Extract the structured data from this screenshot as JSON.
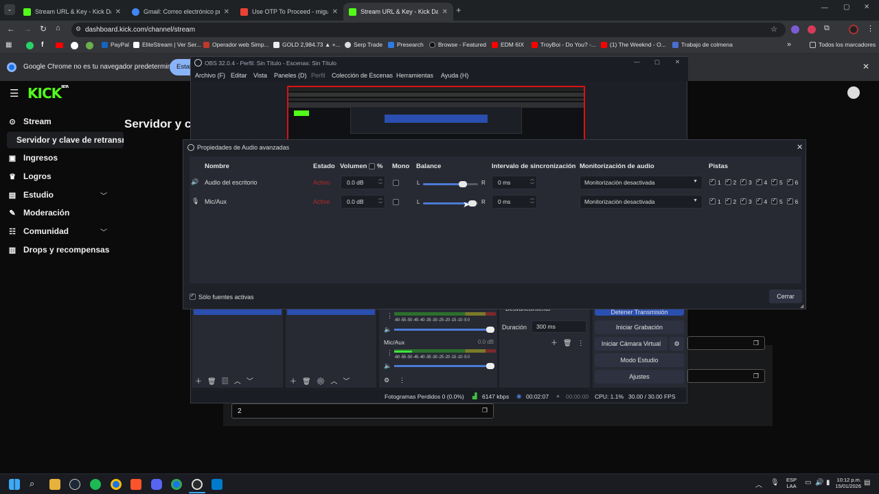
{
  "browser": {
    "tabs": [
      {
        "title": "Stream URL & Key - Kick Dashb",
        "fav": "#53fc18"
      },
      {
        "title": "Gmail: Correo electrónico priva",
        "fav": "#4285f4"
      },
      {
        "title": "Use OTP To Proceed - miguels",
        "fav": "#ea4335"
      },
      {
        "title": "Stream URL & Key - Kick Dashb",
        "fav": "#53fc18"
      }
    ],
    "new_tab": "+",
    "url": "dashboard.kick.com/channel/stream",
    "bookmarks": [
      "PayPal",
      "EliteStream | Ver Ser...",
      "Operador web Simp...",
      "GOLD 2,984.73 ▲ +...",
      "Serp Trade",
      "Presearch",
      "Browse - Featured",
      "EDM 6IX",
      "TroyBoi - Do You? -...",
      "(1) The Weeknd - O...",
      "Trabajo de colmena"
    ],
    "bookmarks_more": "»",
    "all_bookmarks": "Todos los marcadores",
    "infobar_text": "Google Chrome no es tu navegador predeterminado",
    "infobar_button": "Estab"
  },
  "kick": {
    "logo": "KICK",
    "logo_badge": "BETA",
    "sidebar": [
      {
        "label": "Stream",
        "icon": "broadcast-icon"
      },
      {
        "label": "Servidor y clave de retransm",
        "icon": ""
      },
      {
        "label": "Ingresos",
        "icon": "money-icon"
      },
      {
        "label": "Logros",
        "icon": "trophy-icon"
      },
      {
        "label": "Estudio",
        "icon": "studio-icon"
      },
      {
        "label": "Moderación",
        "icon": "wrench-icon"
      },
      {
        "label": "Comunidad",
        "icon": "community-icon"
      },
      {
        "label": "Drops y recompensas",
        "icon": "drops-icon"
      }
    ],
    "heading": "Servidor y cl",
    "field_value": "2"
  },
  "obs": {
    "title": "OBS 32.0.4 - Perfil: Sin Título - Escenas: Sin Título",
    "menu": [
      "Archivo (F)",
      "Editar",
      "Vista",
      "Paneles (D)",
      "Perfil",
      "Colección de Escenas",
      "Herramientas",
      "Ayuda (H)"
    ],
    "mixer_track": "Mic/Aux",
    "mixer_db": "0.0 dB",
    "meter_scale": "-60 -55 -50 -45 -40 -35 -30 -25 -20 -15 -10 -5 0",
    "transition_label": "Desvanecimiento",
    "duration_label": "Duración",
    "duration_value": "300 ms",
    "controls": [
      "Detener Transmisión",
      "Iniciar Grabación",
      "Iniciar Cámara Virtual",
      "Modo Estudio",
      "Ajustes"
    ],
    "status": {
      "dropped": "Fotogramas Perdidos 0 (0.0%)",
      "bitrate": "6147 kbps",
      "live_time": "00:02:07",
      "rec_time": "00:00:00",
      "cpu": "CPU: 1.1%",
      "fps": "30.00 / 30.00 FPS"
    }
  },
  "dialog": {
    "title": "Propiedades de Audio avanzadas",
    "headers": {
      "name": "Nombre",
      "status": "Estado",
      "volume": "Volumen",
      "percent": "%",
      "mono": "Mono",
      "balance": "Balance",
      "sync": "Intervalo de sincronización",
      "monitor": "Monitorización de audio",
      "tracks": "Pistas"
    },
    "rows": [
      {
        "name": "Audio del escritorio",
        "status": "Activo",
        "volume": "0.0 dB",
        "balance_pos": 0.8,
        "sync": "0 ms",
        "monitor": "Monitorización desactivada"
      },
      {
        "name": "Mic/Aux",
        "status": "Activo",
        "volume": "0.0 dB",
        "balance_pos": 1.0,
        "sync": "0 ms",
        "monitor": "Monitorización desactivada"
      }
    ],
    "balance_left": "L",
    "balance_right": "R",
    "track_numbers": [
      "1",
      "2",
      "3",
      "4",
      "5",
      "6"
    ],
    "only_active": "Sólo fuentes activas",
    "close_button": "Cerrar"
  },
  "taskbar": {
    "lang": "ESP",
    "lang2": "LAA",
    "time": "10:12 p.m.",
    "date": "15/01/2026"
  }
}
